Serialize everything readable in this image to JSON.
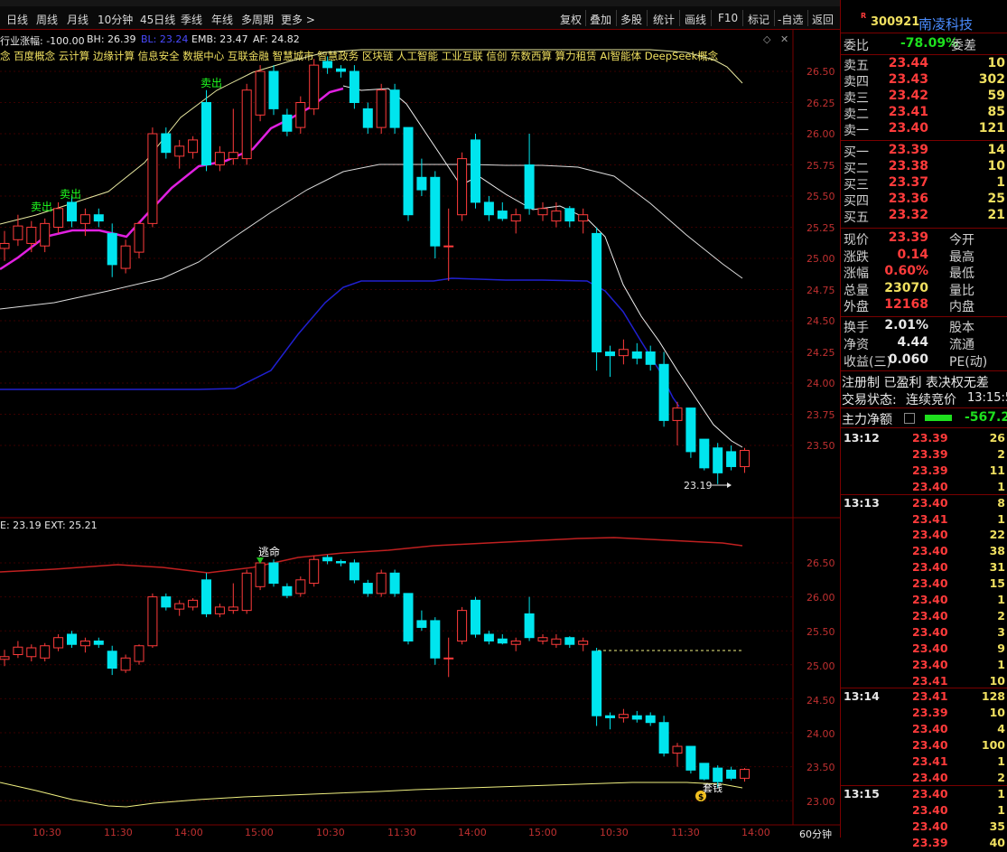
{
  "periods": [
    "日线",
    "周线",
    "月线",
    "10分钟",
    "45日线",
    "季线",
    "年线",
    "多周期",
    "更多 >"
  ],
  "toolbar": [
    "复权",
    "叠加",
    "多股",
    "统计",
    "画线",
    "F10",
    "标记",
    "-自选",
    "返回"
  ],
  "chart_info": {
    "main_label": "行业涨幅: -100.00",
    "bh": "BH: 26.39",
    "bl": "BL: 23.24",
    "emb": "EMB: 23.47",
    "af": "AF: 24.82",
    "concepts": "念 百度概念 云计算 边缘计算 信息安全 数据中心 互联金融 智慧城市 智慧政务 区块链 人工智能 工业互联 信创 东数西算 算力租赁 AI智能体 DeepSeek概念",
    "lower_label": "E: 23.19 EXT: 25.21"
  },
  "annotations": {
    "sell1": "卖出",
    "sell2": "卖出",
    "sell3": "卖出",
    "escape": "逃命",
    "low_price": "23.19",
    "money": "$",
    "money_text": "套钱"
  },
  "price_ticks_top": [
    "26.50",
    "26.25",
    "26.00",
    "25.75",
    "25.50",
    "25.25",
    "25.00",
    "24.75",
    "24.50",
    "24.25",
    "24.00",
    "23.75",
    "23.50"
  ],
  "price_ticks_bottom": [
    "26.50",
    "26.00",
    "25.50",
    "25.00",
    "24.50",
    "24.00",
    "23.50",
    "23.00"
  ],
  "time_ticks": [
    "10:30",
    "11:30",
    "14:00",
    "15:00",
    "10:30",
    "11:30",
    "14:00",
    "15:00",
    "10:30",
    "11:30",
    "14:00"
  ],
  "timeframe": "60分钟",
  "colors": {
    "up": "#ff3b3b",
    "down": "#00e5ee",
    "border": "#7a0000"
  },
  "chart_data": {
    "type": "candlestick",
    "y_range": [
      23.1,
      26.8
    ],
    "candles": [
      {
        "o": 25.08,
        "h": 25.22,
        "l": 24.98,
        "c": 25.12
      },
      {
        "o": 25.15,
        "h": 25.35,
        "l": 25.1,
        "c": 25.26
      },
      {
        "o": 25.12,
        "h": 25.3,
        "l": 25.05,
        "c": 25.25
      },
      {
        "o": 25.1,
        "h": 25.32,
        "l": 25.05,
        "c": 25.28
      },
      {
        "o": 25.25,
        "h": 25.45,
        "l": 25.2,
        "c": 25.4
      },
      {
        "o": 25.45,
        "h": 25.5,
        "l": 25.25,
        "c": 25.3
      },
      {
        "o": 25.28,
        "h": 25.4,
        "l": 25.18,
        "c": 25.35
      },
      {
        "o": 25.35,
        "h": 25.4,
        "l": 25.25,
        "c": 25.3
      },
      {
        "o": 25.2,
        "h": 25.28,
        "l": 24.85,
        "c": 24.95
      },
      {
        "o": 24.92,
        "h": 25.15,
        "l": 24.88,
        "c": 25.1
      },
      {
        "o": 25.05,
        "h": 25.3,
        "l": 25.0,
        "c": 25.28
      },
      {
        "o": 25.28,
        "h": 26.05,
        "l": 25.25,
        "c": 26.0
      },
      {
        "o": 26.0,
        "h": 26.05,
        "l": 25.8,
        "c": 25.85
      },
      {
        "o": 25.82,
        "h": 25.95,
        "l": 25.72,
        "c": 25.9
      },
      {
        "o": 25.85,
        "h": 25.98,
        "l": 25.8,
        "c": 25.95
      },
      {
        "o": 26.25,
        "h": 26.35,
        "l": 25.7,
        "c": 25.75
      },
      {
        "o": 25.75,
        "h": 25.9,
        "l": 25.7,
        "c": 25.85
      },
      {
        "o": 25.8,
        "h": 26.2,
        "l": 25.75,
        "c": 25.85
      },
      {
        "o": 25.8,
        "h": 26.4,
        "l": 25.75,
        "c": 26.35
      },
      {
        "o": 26.15,
        "h": 26.55,
        "l": 26.1,
        "c": 26.5
      },
      {
        "o": 26.5,
        "h": 26.55,
        "l": 26.15,
        "c": 26.2
      },
      {
        "o": 26.15,
        "h": 26.2,
        "l": 25.98,
        "c": 26.02
      },
      {
        "o": 26.05,
        "h": 26.3,
        "l": 26.0,
        "c": 26.25
      },
      {
        "o": 26.2,
        "h": 26.6,
        "l": 26.15,
        "c": 26.55
      },
      {
        "o": 26.58,
        "h": 26.62,
        "l": 26.48,
        "c": 26.53
      },
      {
        "o": 26.52,
        "h": 26.55,
        "l": 26.45,
        "c": 26.5
      },
      {
        "o": 26.5,
        "h": 26.55,
        "l": 26.2,
        "c": 26.25
      },
      {
        "o": 26.2,
        "h": 26.25,
        "l": 26.0,
        "c": 26.05
      },
      {
        "o": 26.05,
        "h": 26.4,
        "l": 26.0,
        "c": 26.35
      },
      {
        "o": 26.35,
        "h": 26.4,
        "l": 26.0,
        "c": 26.05
      },
      {
        "o": 26.05,
        "h": 26.05,
        "l": 25.3,
        "c": 25.35
      },
      {
        "o": 25.65,
        "h": 25.8,
        "l": 25.5,
        "c": 25.55
      },
      {
        "o": 25.65,
        "h": 25.7,
        "l": 25.0,
        "c": 25.1
      },
      {
        "o": 25.1,
        "h": 25.4,
        "l": 24.82,
        "c": 25.1
      },
      {
        "o": 25.35,
        "h": 25.85,
        "l": 25.3,
        "c": 25.8
      },
      {
        "o": 25.95,
        "h": 26.0,
        "l": 25.4,
        "c": 25.45
      },
      {
        "o": 25.45,
        "h": 25.5,
        "l": 25.3,
        "c": 25.35
      },
      {
        "o": 25.38,
        "h": 25.45,
        "l": 25.3,
        "c": 25.32
      },
      {
        "o": 25.3,
        "h": 25.4,
        "l": 25.2,
        "c": 25.35
      },
      {
        "o": 25.75,
        "h": 26.0,
        "l": 25.35,
        "c": 25.4
      },
      {
        "o": 25.35,
        "h": 25.45,
        "l": 25.3,
        "c": 25.4
      },
      {
        "o": 25.3,
        "h": 25.45,
        "l": 25.25,
        "c": 25.38
      },
      {
        "o": 25.4,
        "h": 25.42,
        "l": 25.25,
        "c": 25.3
      },
      {
        "o": 25.3,
        "h": 25.4,
        "l": 25.2,
        "c": 25.35
      },
      {
        "o": 25.2,
        "h": 25.25,
        "l": 24.1,
        "c": 24.25
      },
      {
        "o": 24.25,
        "h": 24.3,
        "l": 24.05,
        "c": 24.22
      },
      {
        "o": 24.22,
        "h": 24.35,
        "l": 24.15,
        "c": 24.27
      },
      {
        "o": 24.25,
        "h": 24.32,
        "l": 24.15,
        "c": 24.2
      },
      {
        "o": 24.25,
        "h": 24.3,
        "l": 24.1,
        "c": 24.15
      },
      {
        "o": 24.15,
        "h": 24.25,
        "l": 23.65,
        "c": 23.7
      },
      {
        "o": 23.7,
        "h": 23.85,
        "l": 23.5,
        "c": 23.8
      },
      {
        "o": 23.8,
        "h": 23.8,
        "l": 23.4,
        "c": 23.45
      },
      {
        "o": 23.55,
        "h": 23.55,
        "l": 23.3,
        "c": 23.32
      },
      {
        "o": 23.48,
        "h": 23.52,
        "l": 23.19,
        "c": 23.28
      },
      {
        "o": 23.45,
        "h": 23.5,
        "l": 23.3,
        "c": 23.33
      },
      {
        "o": 23.33,
        "h": 23.48,
        "l": 23.28,
        "c": 23.46
      }
    ]
  },
  "quote": {
    "code": "300921",
    "name": "南凌科技",
    "weibi_label": "委比",
    "weibi": "-78.09%",
    "weicha_label": "委差",
    "asks": [
      {
        "label": "卖五",
        "price": "23.44",
        "vol": "10"
      },
      {
        "label": "卖四",
        "price": "23.43",
        "vol": "302"
      },
      {
        "label": "卖三",
        "price": "23.42",
        "vol": "59"
      },
      {
        "label": "卖二",
        "price": "23.41",
        "vol": "85"
      },
      {
        "label": "卖一",
        "price": "23.40",
        "vol": "121"
      }
    ],
    "bids": [
      {
        "label": "买一",
        "price": "23.39",
        "vol": "14"
      },
      {
        "label": "买二",
        "price": "23.38",
        "vol": "10"
      },
      {
        "label": "买三",
        "price": "23.37",
        "vol": "1"
      },
      {
        "label": "买四",
        "price": "23.36",
        "vol": "25"
      },
      {
        "label": "买五",
        "price": "23.32",
        "vol": "21"
      }
    ],
    "stats1": [
      {
        "label": "现价",
        "val": "23.39",
        "side": "今开"
      },
      {
        "label": "涨跌",
        "val": "0.14",
        "side": "最高"
      },
      {
        "label": "涨幅",
        "val": "0.60%",
        "side": "最低"
      },
      {
        "label": "总量",
        "val": "23070",
        "side": "量比"
      },
      {
        "label": "外盘",
        "val": "12168",
        "side": "内盘"
      }
    ],
    "stats2": [
      {
        "label": "换手",
        "val": "2.01%",
        "side": "股本"
      },
      {
        "label": "净资",
        "val": "4.44",
        "side": "流通"
      },
      {
        "label": "收益(三)",
        "val": "0.060",
        "side": "PE(动)"
      }
    ],
    "reg_text": "注册制 已盈利 表决权无差",
    "trade_status_label": "交易状态:",
    "trade_status": "连续竞价",
    "trade_time": "13:15:5",
    "main_net_label": "主力净额",
    "main_net_value": "-567.2"
  },
  "ticks": [
    {
      "time": "13:12",
      "price": "23.39",
      "vol": "26",
      "col": "red"
    },
    {
      "time": "",
      "price": "23.39",
      "vol": "2",
      "col": "red"
    },
    {
      "time": "",
      "price": "23.39",
      "vol": "11",
      "col": "red"
    },
    {
      "time": "",
      "price": "23.40",
      "vol": "1",
      "col": "red"
    },
    {
      "time": "13:13",
      "price": "23.40",
      "vol": "8",
      "col": "red"
    },
    {
      "time": "",
      "price": "23.41",
      "vol": "1",
      "col": "red"
    },
    {
      "time": "",
      "price": "23.40",
      "vol": "22",
      "col": "red"
    },
    {
      "time": "",
      "price": "23.40",
      "vol": "38",
      "col": "red"
    },
    {
      "time": "",
      "price": "23.40",
      "vol": "31",
      "col": "red"
    },
    {
      "time": "",
      "price": "23.40",
      "vol": "15",
      "col": "red"
    },
    {
      "time": "",
      "price": "23.40",
      "vol": "1",
      "col": "red"
    },
    {
      "time": "",
      "price": "23.40",
      "vol": "2",
      "col": "red"
    },
    {
      "time": "",
      "price": "23.40",
      "vol": "3",
      "col": "red"
    },
    {
      "time": "",
      "price": "23.40",
      "vol": "9",
      "col": "red"
    },
    {
      "time": "",
      "price": "23.40",
      "vol": "1",
      "col": "red"
    },
    {
      "time": "",
      "price": "23.41",
      "vol": "10",
      "col": "red"
    },
    {
      "time": "13:14",
      "price": "23.41",
      "vol": "128",
      "col": "red"
    },
    {
      "time": "",
      "price": "23.39",
      "vol": "10",
      "col": "red"
    },
    {
      "time": "",
      "price": "23.40",
      "vol": "4",
      "col": "red"
    },
    {
      "time": "",
      "price": "23.40",
      "vol": "100",
      "col": "red"
    },
    {
      "time": "",
      "price": "23.41",
      "vol": "1",
      "col": "red"
    },
    {
      "time": "",
      "price": "23.40",
      "vol": "2",
      "col": "red"
    },
    {
      "time": "13:15",
      "price": "23.40",
      "vol": "1",
      "col": "red"
    },
    {
      "time": "",
      "price": "23.40",
      "vol": "1",
      "col": "red"
    },
    {
      "time": "",
      "price": "23.40",
      "vol": "35",
      "col": "red"
    },
    {
      "time": "",
      "price": "23.39",
      "vol": "40",
      "col": "red"
    }
  ]
}
